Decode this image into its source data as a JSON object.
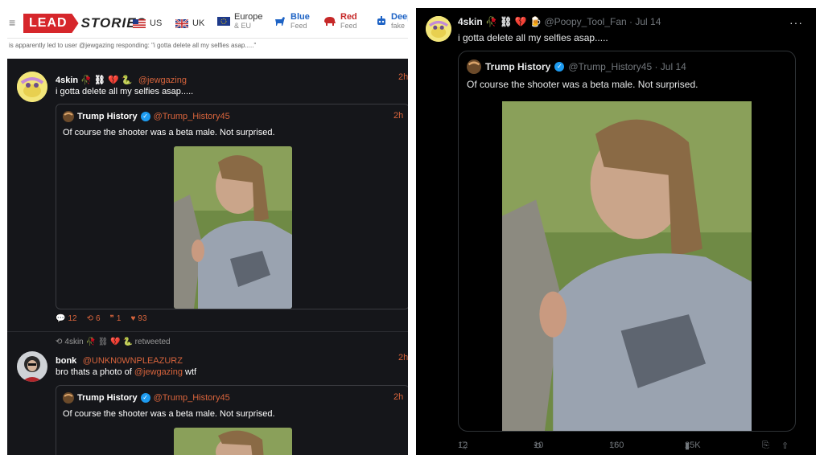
{
  "left": {
    "nav": {
      "logo_lead": "LEAD",
      "logo_stories": "STORIES",
      "items": [
        {
          "label": "US",
          "sub": ""
        },
        {
          "label": "UK",
          "sub": ""
        },
        {
          "label": "Europe",
          "sub": "& EU"
        },
        {
          "label": "Blue",
          "sub": "Feed"
        },
        {
          "label": "Red",
          "sub": "Feed"
        },
        {
          "label": "Deep",
          "sub": "fake"
        }
      ]
    },
    "caption": "is apparently led to user @jewgazing responding: \"i gotta delete all my selfies asap.....\"",
    "tweet1": {
      "name": "4skin 🥀 ⛓ 💔 🐍",
      "handle": "@jewgazing",
      "time": "2h",
      "text": "i gotta delete all my selfies asap.....",
      "quote": {
        "name": "Trump History",
        "handle": "@Trump_History45",
        "time": "2h",
        "text": "Of course the shooter was a beta male. Not surprised."
      },
      "stats": {
        "replies": "12",
        "retweets": "6",
        "quotes": "1",
        "likes": "93"
      }
    },
    "tweet2": {
      "retweeted_by": "4skin 🥀 ⛓ 💔 🐍 retweeted",
      "name": "bonk",
      "handle": "@UNKN0WNPLEAZURZ",
      "time": "2h",
      "text_prefix": "bro thats a photo of ",
      "text_mention": "@jewgazing",
      "text_suffix": " wtf",
      "quote": {
        "name": "Trump History",
        "handle": "@Trump_History45",
        "time": "2h",
        "text": "Of course the shooter was a beta male. Not surprised."
      }
    }
  },
  "right": {
    "name": "4skin 🥀 ⛓ 💔 🍺",
    "handle": "@Poopy_Tool_Fan · Jul 14",
    "text": "i gotta delete all my selfies asap.....",
    "quote": {
      "name": "Trump History",
      "handle": "@Trump_History45 · Jul 14",
      "text": "Of course the shooter was a beta male. Not surprised."
    },
    "actions": {
      "replies": "12",
      "retweets": "10",
      "likes": "160",
      "views": "25K"
    }
  },
  "colors": {
    "accent_orange": "#d8643c",
    "x_grey": "#71767b",
    "verified_blue": "#1d9bf0",
    "lead_red": "#d6262b"
  }
}
